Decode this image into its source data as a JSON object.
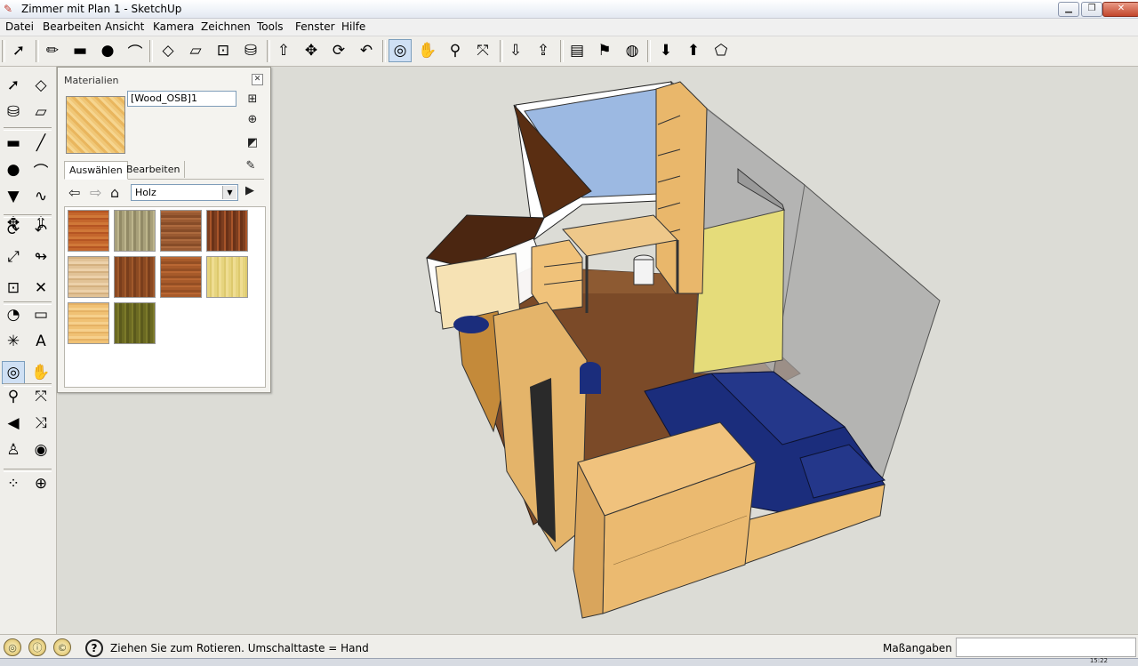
{
  "window": {
    "title": "Zimmer mit Plan 1 - SketchUp"
  },
  "menu": [
    "Datei",
    "Bearbeiten",
    "Ansicht",
    "Kamera",
    "Zeichnen",
    "Tools",
    "Fenster",
    "Hilfe"
  ],
  "toolbar_top": [
    {
      "name": "select-icon",
      "glyph": "➚"
    },
    {
      "name": "pencil-icon",
      "glyph": "✏"
    },
    {
      "name": "rectangle-icon",
      "glyph": "▬"
    },
    {
      "name": "circle-icon",
      "glyph": "●"
    },
    {
      "name": "arc-icon",
      "glyph": "⌒"
    },
    {
      "name": "make-component-icon",
      "glyph": "◇"
    },
    {
      "name": "eraser-icon",
      "glyph": "▱"
    },
    {
      "name": "tape-measure-icon",
      "glyph": "⊡"
    },
    {
      "name": "paint-bucket-icon",
      "glyph": "⛁"
    },
    {
      "name": "push-pull-icon",
      "glyph": "⇧"
    },
    {
      "name": "move-icon",
      "glyph": "✥"
    },
    {
      "name": "rotate-icon",
      "glyph": "⟳"
    },
    {
      "name": "follow-me-icon",
      "glyph": "↶"
    },
    {
      "name": "orbit-icon",
      "glyph": "◎"
    },
    {
      "name": "pan-icon",
      "glyph": "✋"
    },
    {
      "name": "zoom-icon",
      "glyph": "⚲"
    },
    {
      "name": "zoom-extents-icon",
      "glyph": "⤧"
    },
    {
      "name": "get-models-icon",
      "glyph": "⇩"
    },
    {
      "name": "share-model-icon",
      "glyph": "⇪"
    },
    {
      "name": "components-icon",
      "glyph": "▤"
    },
    {
      "name": "place-model-icon",
      "glyph": "⚑"
    },
    {
      "name": "google-earth-icon",
      "glyph": "◍"
    },
    {
      "name": "get-current-view-icon",
      "glyph": "⬇"
    },
    {
      "name": "toggle-terrain-icon",
      "glyph": "⬆"
    },
    {
      "name": "photo-texture-icon",
      "glyph": "⬠"
    }
  ],
  "toolbar_left": [
    {
      "name": "select-icon",
      "glyph": "➚"
    },
    {
      "name": "make-component-icon",
      "glyph": "◇"
    },
    {
      "name": "paint-bucket-icon",
      "glyph": "⛁"
    },
    {
      "name": "eraser-icon",
      "glyph": "▱"
    },
    {
      "name": "rectangle-icon",
      "glyph": "▬"
    },
    {
      "name": "line-icon",
      "glyph": "╱"
    },
    {
      "name": "circle-icon",
      "glyph": "●"
    },
    {
      "name": "arc-icon",
      "glyph": "⌒"
    },
    {
      "name": "polygon-icon",
      "glyph": "▼"
    },
    {
      "name": "freehand-icon",
      "glyph": "∿"
    },
    {
      "name": "move-icon",
      "glyph": "✥"
    },
    {
      "name": "push-pull-icon",
      "glyph": "⇧"
    },
    {
      "name": "rotate-icon",
      "glyph": "⟳"
    },
    {
      "name": "follow-me-icon",
      "glyph": "↶"
    },
    {
      "name": "scale-icon",
      "glyph": "⤢"
    },
    {
      "name": "offset-icon",
      "glyph": "↬"
    },
    {
      "name": "tape-measure-icon",
      "glyph": "⊡"
    },
    {
      "name": "dimension-icon",
      "glyph": "✕"
    },
    {
      "name": "protractor-icon",
      "glyph": "◔"
    },
    {
      "name": "text-icon",
      "glyph": "▭"
    },
    {
      "name": "axes-icon",
      "glyph": "✳"
    },
    {
      "name": "3d-text-icon",
      "glyph": "A"
    },
    {
      "name": "orbit-icon",
      "glyph": "◎"
    },
    {
      "name": "pan-icon",
      "glyph": "✋"
    },
    {
      "name": "zoom-icon",
      "glyph": "⚲"
    },
    {
      "name": "zoom-window-icon",
      "glyph": "⤧"
    },
    {
      "name": "previous-view-icon",
      "glyph": "◀"
    },
    {
      "name": "zoom-extents-icon",
      "glyph": "⤨"
    },
    {
      "name": "position-camera-icon",
      "glyph": "♙"
    },
    {
      "name": "look-around-icon",
      "glyph": "◉"
    },
    {
      "name": "walk-icon",
      "glyph": "⁘"
    },
    {
      "name": "section-plane-icon",
      "glyph": "⊕"
    }
  ],
  "materials_panel": {
    "title": "Materialien",
    "material_name": "[Wood_OSB]1",
    "tab_select": "Auswählen",
    "tab_edit": "Bearbeiten",
    "collection": "Holz",
    "swatches": [
      {
        "name": "wood-swatch-1",
        "colors": [
          "#c4662c",
          "#b55523",
          "#d07838"
        ]
      },
      {
        "name": "wood-swatch-2",
        "colors": [
          "#a8a07a",
          "#bdb58c",
          "#928a66"
        ]
      },
      {
        "name": "wood-swatch-3",
        "colors": [
          "#9a5a32",
          "#ad6a3e",
          "#874c28"
        ]
      },
      {
        "name": "wood-swatch-4",
        "colors": [
          "#7d3e1f",
          "#a8552a",
          "#6a3218"
        ]
      },
      {
        "name": "wood-swatch-5",
        "colors": [
          "#e1c296",
          "#d4b07f",
          "#ecd1aa"
        ]
      },
      {
        "name": "wood-swatch-6",
        "colors": [
          "#8c4a22",
          "#a0592b",
          "#7a3e1c"
        ]
      },
      {
        "name": "wood-swatch-7",
        "colors": [
          "#a75a2a",
          "#b96733",
          "#954f24"
        ]
      },
      {
        "name": "wood-swatch-8",
        "colors": [
          "#e6d47e",
          "#ddc96d",
          "#efdd92"
        ]
      },
      {
        "name": "wood-swatch-9",
        "colors": [
          "#f0c174",
          "#e6b264",
          "#f6d08c"
        ]
      },
      {
        "name": "wood-swatch-10",
        "colors": [
          "#6b6a22",
          "#7c7a2a",
          "#5b5a1c"
        ]
      }
    ]
  },
  "status": {
    "hint": "Ziehen Sie zum Rotieren.  Umschalttaste = Hand",
    "measurements_label": "Maßangaben",
    "measurements_value": ""
  },
  "taskbar": {
    "clock": "15:22"
  },
  "colors": {
    "viewport_bg": "#dcdcd6",
    "floor": "#7a4a2a",
    "wood": "#e8b86a",
    "sofa": "#1b2d7c",
    "window": "#9bb8e0"
  }
}
